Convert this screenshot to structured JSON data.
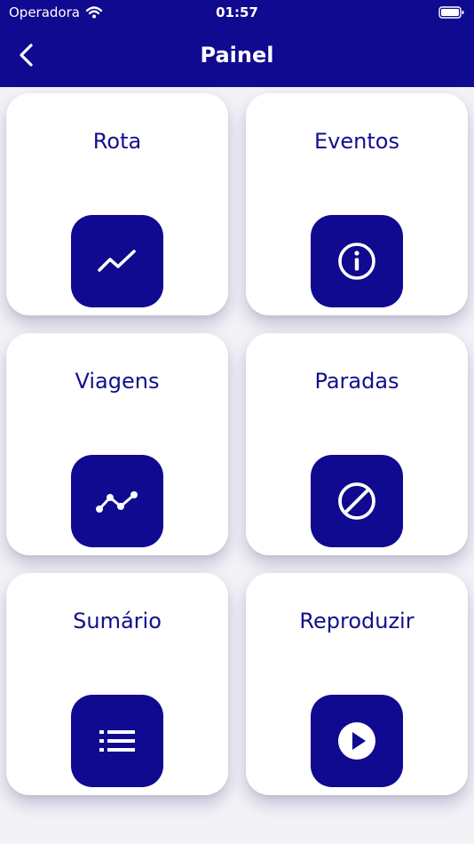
{
  "status_bar": {
    "carrier": "Operadora",
    "time": "01:57"
  },
  "header": {
    "title": "Painel",
    "back_icon": "chevron-left-icon"
  },
  "cards": [
    {
      "label": "Rota",
      "icon": "trend-line-icon"
    },
    {
      "label": "Eventos",
      "icon": "info-icon"
    },
    {
      "label": "Viagens",
      "icon": "route-points-icon"
    },
    {
      "label": "Paradas",
      "icon": "block-icon"
    },
    {
      "label": "Sumário",
      "icon": "list-icon"
    },
    {
      "label": "Reproduzir",
      "icon": "play-icon"
    }
  ],
  "colors": {
    "primary": "#0f0a8f",
    "card_text": "#140f8c",
    "card_background": "#ffffff",
    "page_background": "#f2f2f7"
  }
}
